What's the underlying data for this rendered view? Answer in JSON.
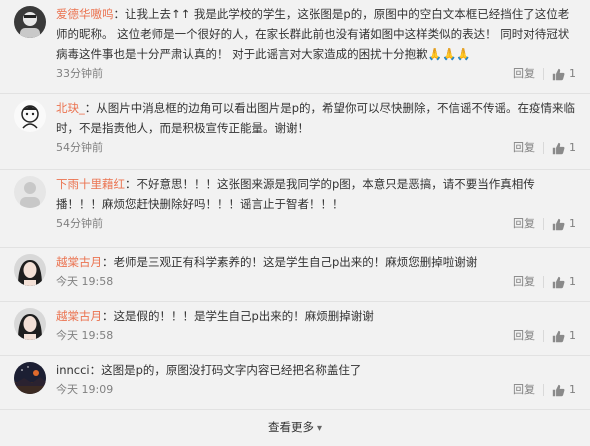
{
  "comments": [
    {
      "username": "爱德华嗷呜",
      "colon": "：",
      "text": "让我上去↑↑ 我是此学校的学生，这张图是p的，原图中的空白文本框已经挡住了这位老师的昵称。 这位老师是一个很好的人，在家长群此前也没有诸如图中这样类似的表达！ 同时对待冠状病毒这件事也是十分严肃认真的！ 对于此谣言对大家造成的困扰十分抱歉🙏🙏🙏",
      "time": "33分钟前",
      "reply_label": "回复",
      "like_count": "1"
    },
    {
      "username": "北玦_",
      "colon": "：",
      "text": "从图片中消息框的边角可以看出图片是p的，希望你可以尽快删除，不信谣不传谣。在疫情来临时，不是指责他人，而是积极宣传正能量。谢谢！",
      "time": "54分钟前",
      "reply_label": "回复",
      "like_count": "1"
    },
    {
      "username": "下雨十里藉红",
      "colon": "：",
      "text": "不好意思！！！这张图来源是我同学的p图，本意只是恶搞，请不要当作真相传播！！！麻烦您赶快删除好吗！！！谣言止于智者！！！",
      "time": "54分钟前",
      "reply_label": "回复",
      "like_count": "1"
    },
    {
      "username": "越棠古月",
      "colon": "：",
      "text": "老师是三观正有科学素养的！这是学生自己p出来的！麻烦您删掉啦谢谢",
      "time": "今天 19:58",
      "reply_label": "回复",
      "like_count": "1"
    },
    {
      "username": "越棠古月",
      "colon": "：",
      "text": "这是假的！！！是学生自己p出来的！麻烦删掉谢谢",
      "time": "今天 19:58",
      "reply_label": "回复",
      "like_count": "1"
    },
    {
      "username": "inncci",
      "colon": "：",
      "text": "这图是p的，原图没打码文字内容已经把名称盖住了",
      "time": "今天 19:09",
      "reply_label": "回复",
      "like_count": "1"
    }
  ],
  "footer": {
    "more_label": "查看更多"
  },
  "colors": {
    "username": "#eb7350",
    "meta": "#808080",
    "background": "#f2f2f2"
  },
  "icons": {
    "like": "thumbs-up-icon",
    "more": "chevron-down-icon",
    "vip": "vip-badge-icon"
  }
}
